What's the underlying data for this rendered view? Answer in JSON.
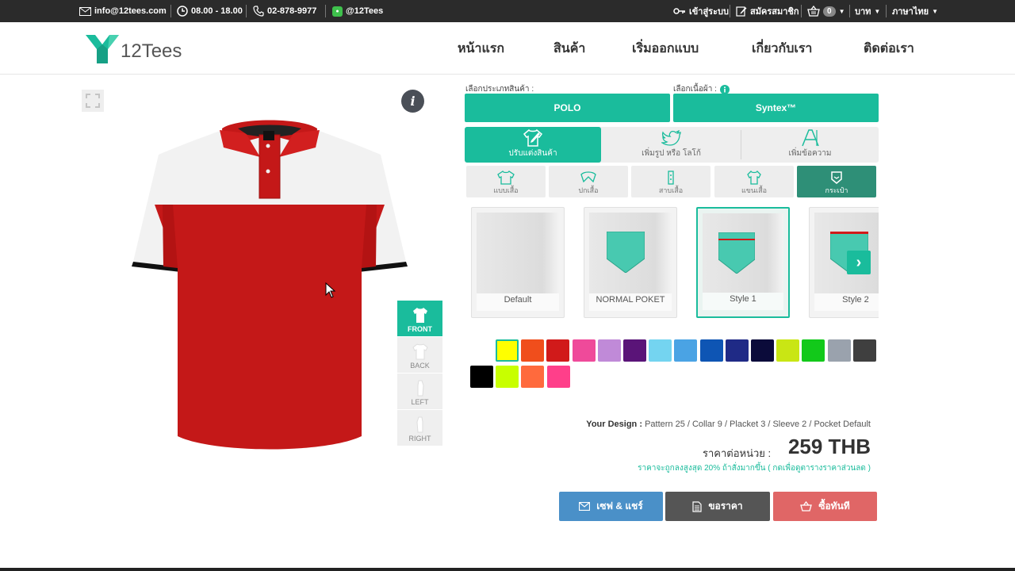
{
  "topbar": {
    "email": "info@12tees.com",
    "hours": "08.00 - 18.00",
    "phone": "02-878-9977",
    "line": "@12Tees",
    "login": "เข้าสู่ระบบ",
    "register": "สมัครสมาชิก",
    "cart_count": "0",
    "currency": "บาท",
    "language": "ภาษาไทย"
  },
  "header": {
    "logo_text": "12Tees",
    "nav": [
      "หน้าแรก",
      "สินค้า",
      "เริ่มออกแบบ",
      "เกี่ยวกับเรา",
      "ติดต่อเรา"
    ]
  },
  "preview": {
    "views": [
      "FRONT",
      "BACK",
      "LEFT",
      "RIGHT"
    ],
    "active_view": "FRONT"
  },
  "config": {
    "product_label": "เลือกประเภทสินค้า :",
    "product_value": "POLO",
    "fabric_label": "เลือกเนื้อผ้า :",
    "fabric_value": "Syntex™",
    "tabs": [
      "ปรับแต่งสินค้า",
      "เพิ่มรูป หรือ โลโก้",
      "เพิ่มข้อความ"
    ],
    "parts": [
      "แบบเสื้อ",
      "ปกเสื้อ",
      "สาบเสื้อ",
      "แขนเสื้อ",
      "กระเป๋า"
    ],
    "pockets": [
      "Default",
      "NORMAL POKET",
      "Style 1",
      "Style 2"
    ],
    "selected_pocket": "Style 1"
  },
  "colors": {
    "row1": [
      "#ffff00",
      "#f04e1c",
      "#d11a1a",
      "#ef4a9a",
      "#c08ad8",
      "#5a1478",
      "#74d4f0",
      "#4aa3e4",
      "#0e55b4",
      "#1f2a86",
      "#0b0b3a",
      "#c9e614",
      "#12c91a",
      "#9aa2ad",
      "#3f3f3f"
    ],
    "row2": [
      "#000000",
      "#c8ff00",
      "#ff6a3d",
      "#ff3f8a"
    ],
    "selected": "#ffff00",
    "accent": "#1abc9c",
    "shirt_red": "#c41818",
    "shirt_white": "#f2f2f2"
  },
  "summary": {
    "design_label": "Your Design :",
    "design_value": "Pattern 25 / Collar 9 / Placket 3 / Sleeve 2 / Pocket Default",
    "price_label": "ราคาต่อหน่วย :",
    "price": "259 THB",
    "note": "ราคาจะถูกลงสูงสุด 20% ถ้าสั่งมากขึ้น ( กดเพื่อดูตารางราคาส่วนลด )"
  },
  "actions": {
    "save": "เซฟ & แชร์",
    "quote": "ขอราคา",
    "buy": "ซื้อทันที"
  }
}
